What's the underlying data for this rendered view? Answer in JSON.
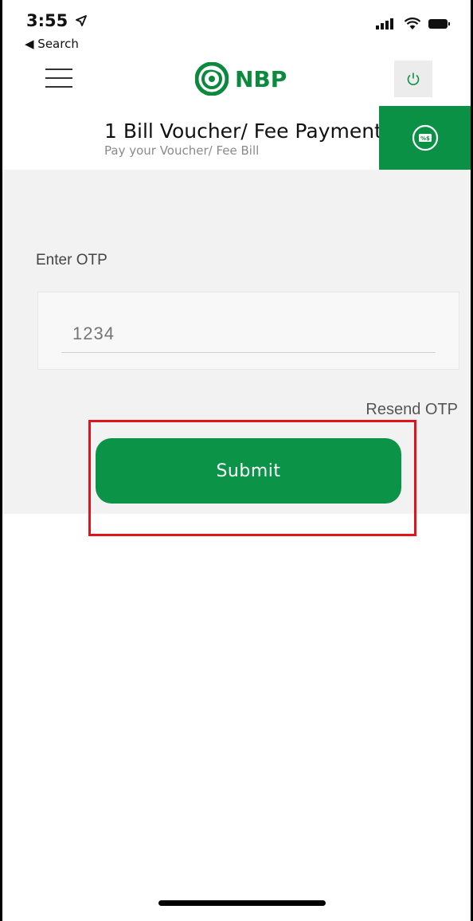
{
  "status_bar": {
    "time": "3:55",
    "back_label": "◀ Search",
    "icons": [
      "location-arrow-icon",
      "signal-icon",
      "wifi-icon",
      "battery-icon"
    ]
  },
  "header": {
    "logo_text": "NBP",
    "menu_icon": "hamburger-icon",
    "power_icon": "power-icon"
  },
  "page": {
    "title": "1 Bill Voucher/ Fee Payment",
    "subtitle": "Pay your Voucher/ Fee Bill",
    "tab_icon": "bill-icon"
  },
  "form": {
    "otp_label": "Enter OTP",
    "otp_placeholder": "1234",
    "resend_label": "Resend OTP",
    "submit_label": "Submit"
  },
  "colors": {
    "brand_green": "#0b9146",
    "highlight_red": "#e0141c"
  }
}
